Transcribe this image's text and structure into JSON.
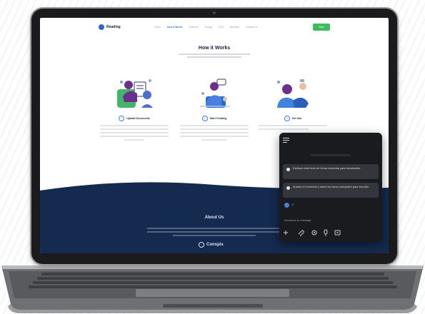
{
  "nav": {
    "logo_text": "Reading",
    "links": [
      "Home",
      "How it Works",
      "Features",
      "Pricing",
      "FAQ",
      "Reviews",
      "Contact Us"
    ],
    "active_index": 1,
    "cta_label": "Start"
  },
  "how_it_works": {
    "title": "How it Works",
    "steps": [
      {
        "number": "1",
        "label": "Upload Documents"
      },
      {
        "number": "2",
        "label": "Start Chatting"
      },
      {
        "number": "3",
        "label": "Get Info"
      }
    ]
  },
  "footer": {
    "about_title": "About Us",
    "logo_text": "Conspis"
  },
  "chat": {
    "suggestions": [
      "Explique este texto de forma resumida para estudiantes.",
      "Analiza el contenido y dame las ideas principales para estudiar."
    ],
    "avatar_text": "Hi",
    "input_placeholder": "Introduce tu mensaje..."
  },
  "colors": {
    "accent_blue": "#3d7be0",
    "cta_green": "#3dbb5e",
    "footer_navy": "#142a4f",
    "chat_bg": "#1a1b1f",
    "suggestion_bg": "#34363d"
  }
}
